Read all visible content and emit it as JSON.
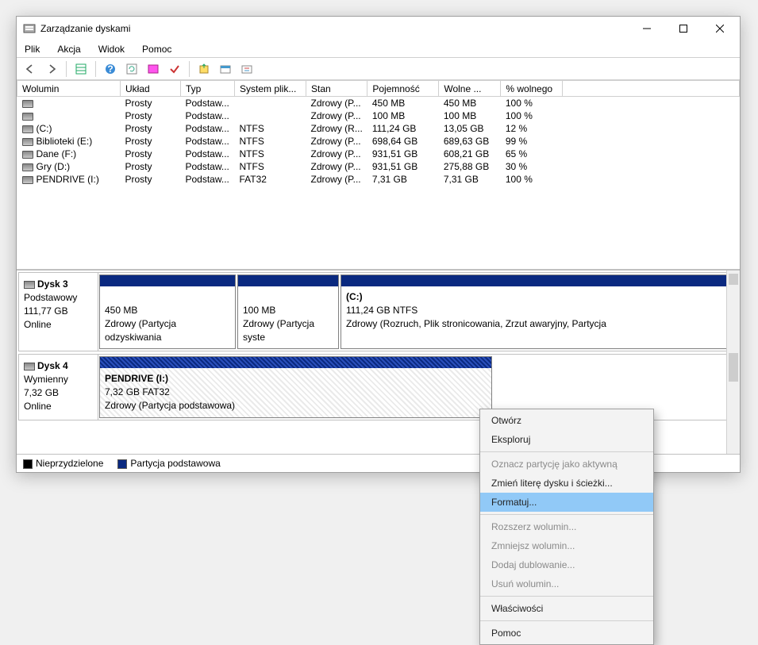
{
  "window": {
    "title": "Zarządzanie dyskami"
  },
  "menu": {
    "file": "Plik",
    "action": "Akcja",
    "view": "Widok",
    "help": "Pomoc"
  },
  "columns": {
    "vol": "Wolumin",
    "layout": "Układ",
    "type": "Typ",
    "fs": "System plik...",
    "state": "Stan",
    "cap": "Pojemność",
    "free": "Wolne ...",
    "pct": "% wolnego"
  },
  "rows": [
    {
      "name": "",
      "layout": "Prosty",
      "type": "Podstaw...",
      "fs": "",
      "state": "Zdrowy (P...",
      "cap": "450 MB",
      "free": "450 MB",
      "pct": "100 %"
    },
    {
      "name": "",
      "layout": "Prosty",
      "type": "Podstaw...",
      "fs": "",
      "state": "Zdrowy (P...",
      "cap": "100 MB",
      "free": "100 MB",
      "pct": "100 %"
    },
    {
      "name": "(C:)",
      "layout": "Prosty",
      "type": "Podstaw...",
      "fs": "NTFS",
      "state": "Zdrowy (R...",
      "cap": "111,24 GB",
      "free": "13,05 GB",
      "pct": "12 %"
    },
    {
      "name": "Biblioteki (E:)",
      "layout": "Prosty",
      "type": "Podstaw...",
      "fs": "NTFS",
      "state": "Zdrowy (P...",
      "cap": "698,64 GB",
      "free": "689,63 GB",
      "pct": "99 %"
    },
    {
      "name": "Dane (F:)",
      "layout": "Prosty",
      "type": "Podstaw...",
      "fs": "NTFS",
      "state": "Zdrowy (P...",
      "cap": "931,51 GB",
      "free": "608,21 GB",
      "pct": "65 %"
    },
    {
      "name": "Gry (D:)",
      "layout": "Prosty",
      "type": "Podstaw...",
      "fs": "NTFS",
      "state": "Zdrowy (P...",
      "cap": "931,51 GB",
      "free": "275,88 GB",
      "pct": "30 %"
    },
    {
      "name": "PENDRIVE (I:)",
      "layout": "Prosty",
      "type": "Podstaw...",
      "fs": "FAT32",
      "state": "Zdrowy (P...",
      "cap": "7,31 GB",
      "free": "7,31 GB",
      "pct": "100 %"
    }
  ],
  "disks": {
    "d3": {
      "name": "Dysk 3",
      "type": "Podstawowy",
      "size": "111,77 GB",
      "status": "Online",
      "p1": {
        "line1": "",
        "line2": "450 MB",
        "line3": "Zdrowy (Partycja odzyskiwania"
      },
      "p2": {
        "line1": "",
        "line2": "100 MB",
        "line3": "Zdrowy (Partycja syste"
      },
      "p3": {
        "line1": "(C:)",
        "line2": "111,24 GB NTFS",
        "line3": "Zdrowy (Rozruch, Plik stronicowania, Zrzut awaryjny, Partycja"
      }
    },
    "d4": {
      "name": "Dysk 4",
      "type": "Wymienny",
      "size": "7,32 GB",
      "status": "Online",
      "p1": {
        "line1": "PENDRIVE  (I:)",
        "line2": "7,32 GB FAT32",
        "line3": "Zdrowy (Partycja podstawowa)"
      }
    }
  },
  "legend": {
    "unalloc": "Nieprzydzielone",
    "primary": "Partycja podstawowa",
    "colors": {
      "unalloc": "#000000",
      "primary": "#0a2980"
    }
  },
  "context": {
    "open": "Otwórz",
    "explore": "Eksploruj",
    "mark_active": "Oznacz partycję jako aktywną",
    "change_letter": "Zmień literę dysku i ścieżki...",
    "format": "Formatuj...",
    "extend": "Rozszerz wolumin...",
    "shrink": "Zmniejsz wolumin...",
    "mirror": "Dodaj dublowanie...",
    "delete": "Usuń wolumin...",
    "props": "Właściwości",
    "help": "Pomoc"
  }
}
